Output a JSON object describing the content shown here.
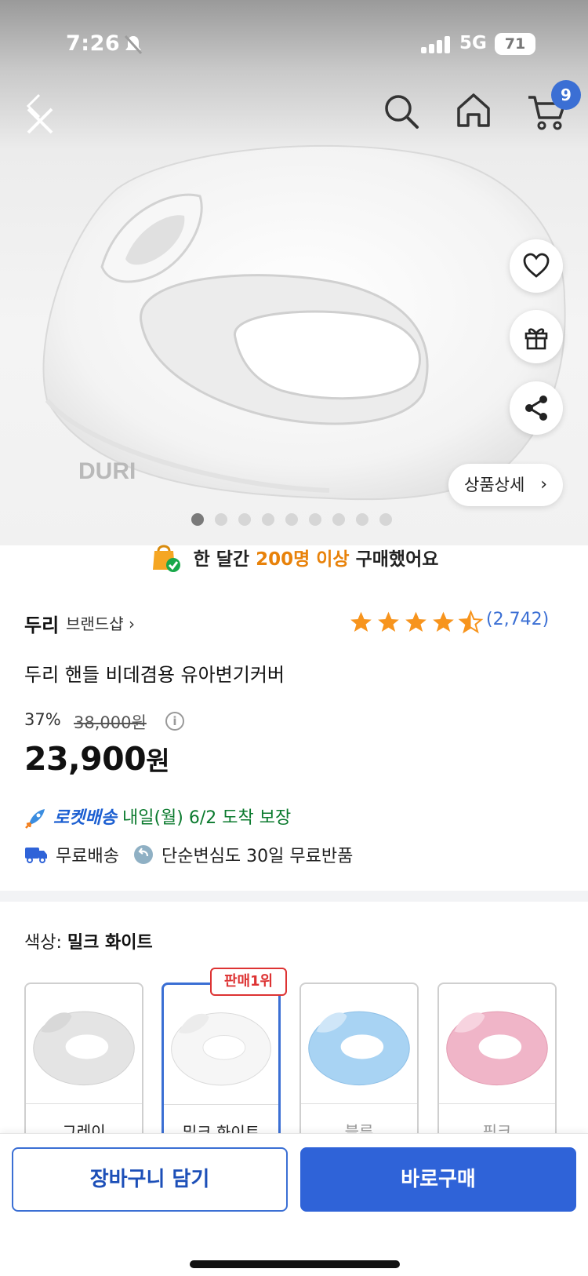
{
  "status_bar": {
    "time": "7:26",
    "network": "5G",
    "battery": "71"
  },
  "nav": {
    "cart_count": "9"
  },
  "gallery": {
    "detail_label": "상품상세",
    "detail_chevron": "›",
    "total_images": 9,
    "active_index": 0
  },
  "purchase_banner": {
    "prefix": "한 달간 ",
    "highlight": "200명 이상",
    "suffix": " 구매했어요"
  },
  "product": {
    "brand": "두리",
    "brand_link": "브랜드샵 ›",
    "rating_stars": 4.5,
    "review_count": "(2,742)",
    "title": "두리 핸들 비데겸용 유아변기커버",
    "discount": "37%",
    "original_price": "38,000원",
    "price_number": "23,900",
    "price_unit": "원"
  },
  "delivery": {
    "rocket_label": "로켓배송",
    "rocket_text": " 내일(월) 6/2 도착 보장",
    "free_shipping": "무료배송",
    "free_return": "단순변심도 30일 무료반품"
  },
  "options": {
    "label": "색상: ",
    "selected": "밀크 화이트",
    "badge": "판매1위",
    "items": [
      {
        "name": "그레이",
        "color": "#e6e6e6"
      },
      {
        "name": "밀크 화이트",
        "color": "#f6f6f6"
      },
      {
        "name": "블루",
        "color": "#a8d3f3"
      },
      {
        "name": "핑크",
        "color": "#f0b5c8"
      }
    ]
  },
  "buttons": {
    "add_to_cart": "장바구니 담기",
    "buy_now": "바로구매"
  },
  "colors": {
    "accent": "#2f63d8",
    "star": "#f7941d",
    "rocket_green": "#0b7a2e",
    "sale_red": "#d33333"
  }
}
